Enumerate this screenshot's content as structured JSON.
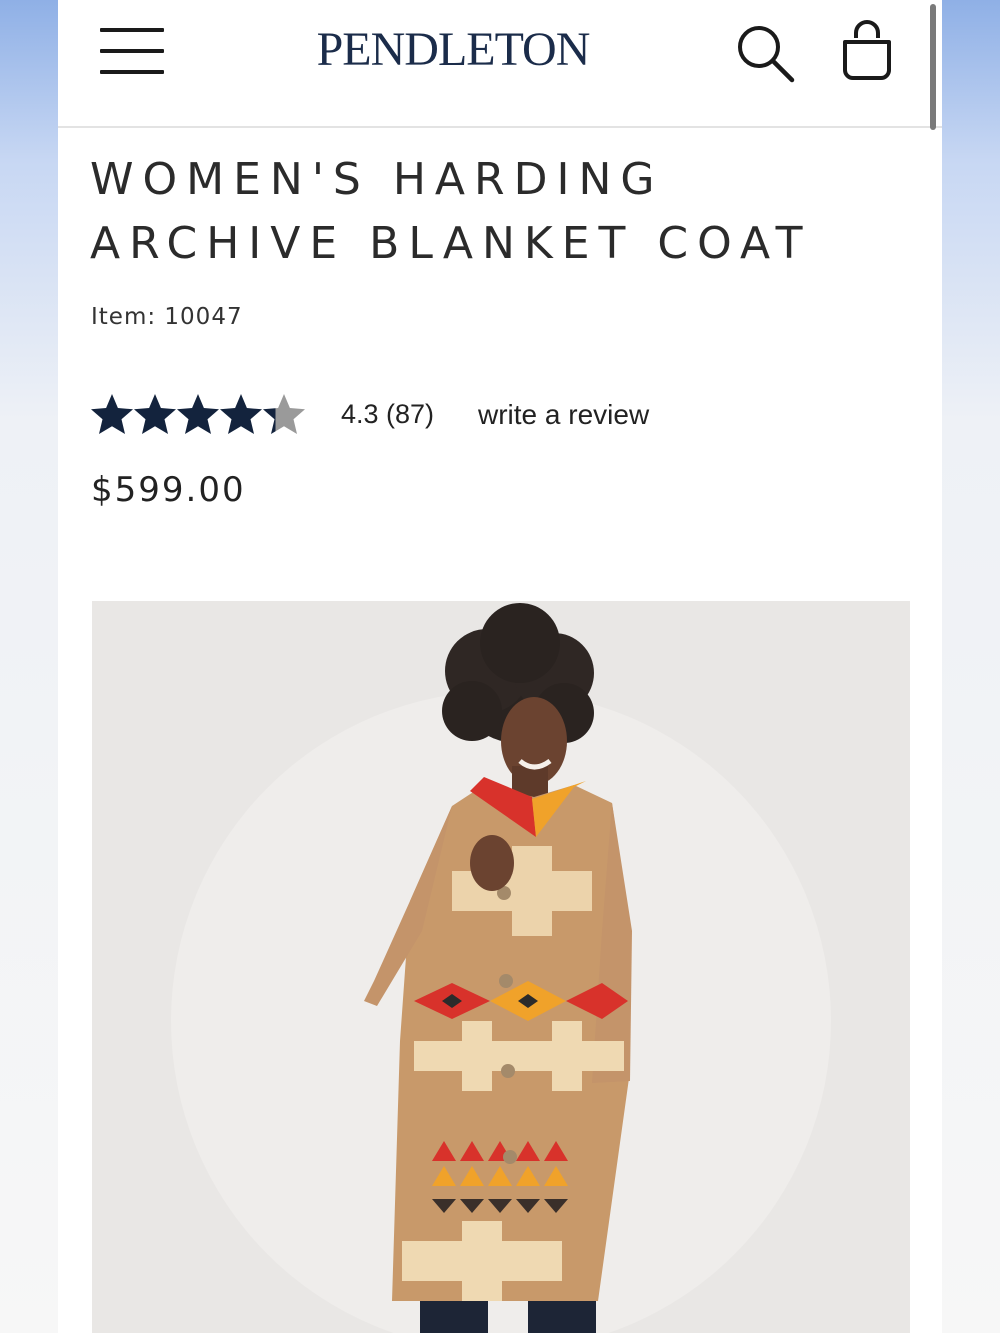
{
  "header": {
    "brand": "PENDLETON",
    "menu_icon": "hamburger-menu-icon",
    "search_icon": "search-icon",
    "bag_icon": "shopping-bag-icon"
  },
  "product": {
    "title": "WOMEN'S HARDING ARCHIVE BLANKET COAT",
    "item_number": "Item: 10047",
    "rating": {
      "stars": 4.3,
      "max_stars": 5,
      "text": "4.3 (87)",
      "review_link": "write a review"
    },
    "price": "$599.00",
    "image_alt": "Model wearing the Harding archive blanket coat"
  },
  "colors": {
    "brand_navy": "#1b2c4a",
    "star_fill": "#13233d",
    "star_empty": "#9a9a9a",
    "coat_tan": "#c8996a",
    "coat_cream": "#efd9b2",
    "accent_red": "#d8322b",
    "accent_orange": "#f0a22a"
  }
}
